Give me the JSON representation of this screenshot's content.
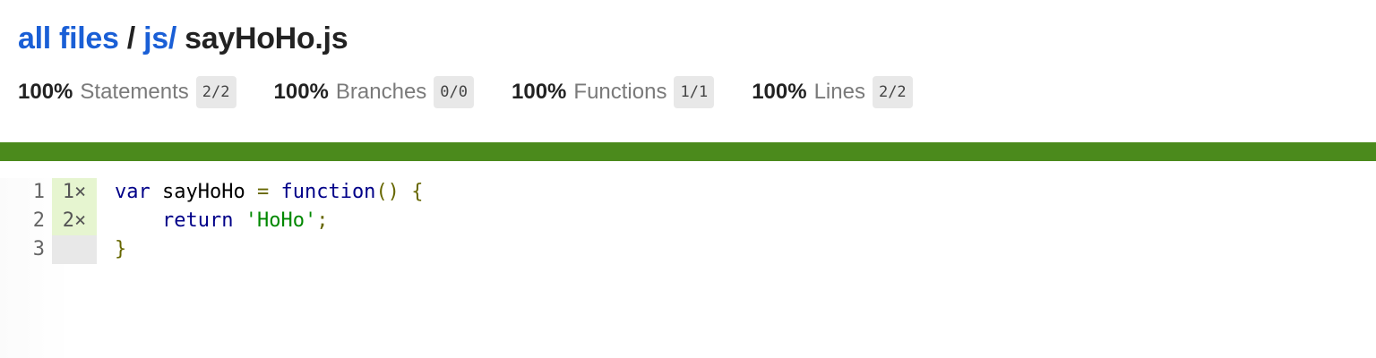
{
  "breadcrumb": {
    "root_link": "all files",
    "separator": "/",
    "folder_link": "js/",
    "file_name": "sayHoHo.js"
  },
  "stats": [
    {
      "pct": "100%",
      "label": "Statements",
      "fraction": "2/2"
    },
    {
      "pct": "100%",
      "label": "Branches",
      "fraction": "0/0"
    },
    {
      "pct": "100%",
      "label": "Functions",
      "fraction": "1/1"
    },
    {
      "pct": "100%",
      "label": "Lines",
      "fraction": "2/2"
    }
  ],
  "status_color": "#4b8a1c",
  "code_lines": [
    {
      "number": "1",
      "hits": "1×",
      "tokens": [
        {
          "t": "var",
          "c": "kw"
        },
        {
          "t": " sayHoHo ",
          "c": "plain"
        },
        {
          "t": "=",
          "c": "punc"
        },
        {
          "t": " ",
          "c": "plain"
        },
        {
          "t": "function",
          "c": "fn-kw"
        },
        {
          "t": "()",
          "c": "punc"
        },
        {
          "t": " ",
          "c": "plain"
        },
        {
          "t": "{",
          "c": "punc"
        }
      ]
    },
    {
      "number": "2",
      "hits": "2×",
      "tokens": [
        {
          "t": "    ",
          "c": "plain"
        },
        {
          "t": "return",
          "c": "kw"
        },
        {
          "t": " ",
          "c": "plain"
        },
        {
          "t": "'HoHo'",
          "c": "str"
        },
        {
          "t": ";",
          "c": "punc"
        }
      ]
    },
    {
      "number": "3",
      "hits": "",
      "tokens": [
        {
          "t": "}",
          "c": "punc"
        }
      ]
    }
  ]
}
